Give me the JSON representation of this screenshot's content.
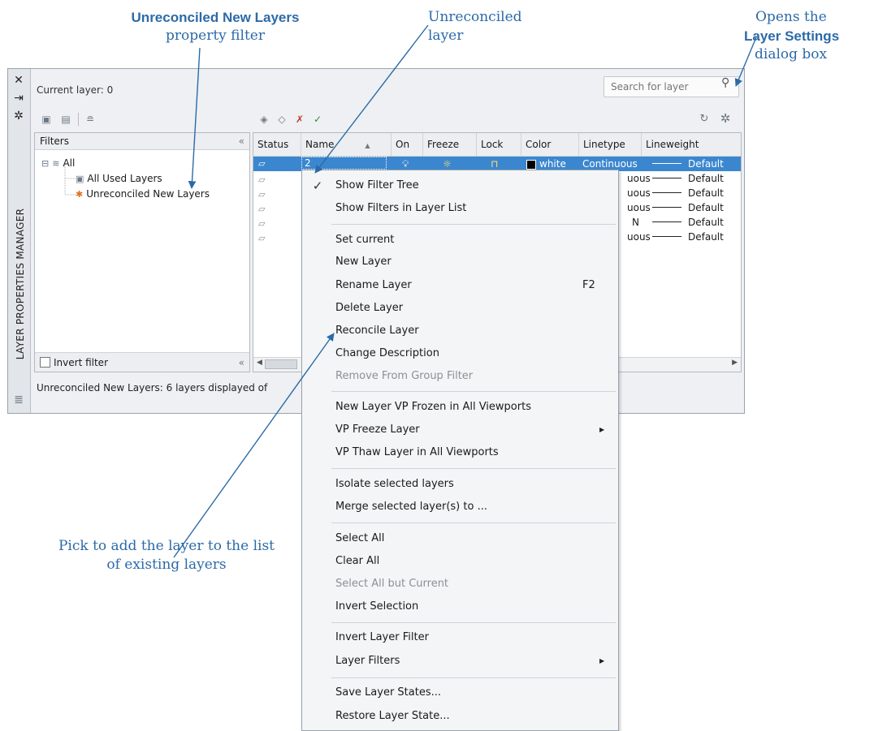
{
  "annotations": {
    "unreconciled_filter": {
      "bold": "Unreconciled New Layers",
      "rest": "property filter"
    },
    "unreconciled_layer": "Unreconciled layer",
    "opens": {
      "prefix": "Opens the",
      "bold": "Layer Settings",
      "suffix": "dialog box"
    },
    "pick_to_add": "Pick to add the layer to the list of existing layers"
  },
  "palette": {
    "vertical_title": "LAYER PROPERTIES MANAGER",
    "current_layer": "Current layer: 0",
    "search_placeholder": "Search for layer",
    "status_line": "Unreconciled New Layers: 6 layers displayed of"
  },
  "filters": {
    "header": "Filters",
    "collapse": "«",
    "tree": [
      {
        "label": "All",
        "glyph": "⊟"
      },
      {
        "label": "All Used Layers"
      },
      {
        "label": "Unreconciled New Layers"
      }
    ],
    "invert_filter": "Invert filter",
    "invert_filter_checked": false
  },
  "layer_list": {
    "columns": [
      "Status",
      "Name",
      "On",
      "Freeze",
      "Lock",
      "Color",
      "Linetype",
      "Lineweight"
    ],
    "rows": [
      {
        "name": "2",
        "color": "white",
        "color_swatch": "#000000",
        "linetype": "Continuous",
        "lineweight": "Default",
        "selected": true
      },
      {
        "linetype": "uous",
        "lineweight": "Default"
      },
      {
        "linetype": "uous",
        "lineweight": "Default"
      },
      {
        "linetype": "uous",
        "lineweight": "Default"
      },
      {
        "linetype": "N",
        "lineweight": "Default"
      },
      {
        "linetype": "uous",
        "lineweight": "Default"
      }
    ]
  },
  "context_menu": {
    "items": [
      {
        "label": "Show Filter Tree",
        "checked": true
      },
      {
        "label": "Show Filters in Layer List"
      },
      {
        "label": "Set current"
      },
      {
        "label": "New Layer"
      },
      {
        "label": "Rename Layer",
        "shortcut": "F2"
      },
      {
        "label": "Delete Layer"
      },
      {
        "label": "Reconcile Layer"
      },
      {
        "label": "Change Description"
      },
      {
        "label": "Remove From Group Filter",
        "disabled": true
      },
      {
        "label": "New Layer VP Frozen in All Viewports"
      },
      {
        "label": "VP Freeze Layer",
        "submenu": true
      },
      {
        "label": "VP Thaw Layer in All Viewports"
      },
      {
        "label": "Isolate selected layers"
      },
      {
        "label": "Merge selected layer(s) to ..."
      },
      {
        "label": "Select All"
      },
      {
        "label": "Clear All"
      },
      {
        "label": "Select All but Current",
        "disabled": true
      },
      {
        "label": "Invert Selection"
      },
      {
        "label": "Invert Layer Filter"
      },
      {
        "label": "Layer Filters",
        "submenu": true
      },
      {
        "label": "Save Layer States..."
      },
      {
        "label": "Restore Layer State..."
      }
    ]
  },
  "colors": {
    "accent": "#2c6aa8",
    "selection": "#3b87cf"
  },
  "icons": {
    "close": "close-icon",
    "autohide": "autohide-icon",
    "properties": "gear-icon",
    "refresh": "refresh-icon",
    "settings": "settings-gear-icon",
    "search": "search-icon"
  }
}
